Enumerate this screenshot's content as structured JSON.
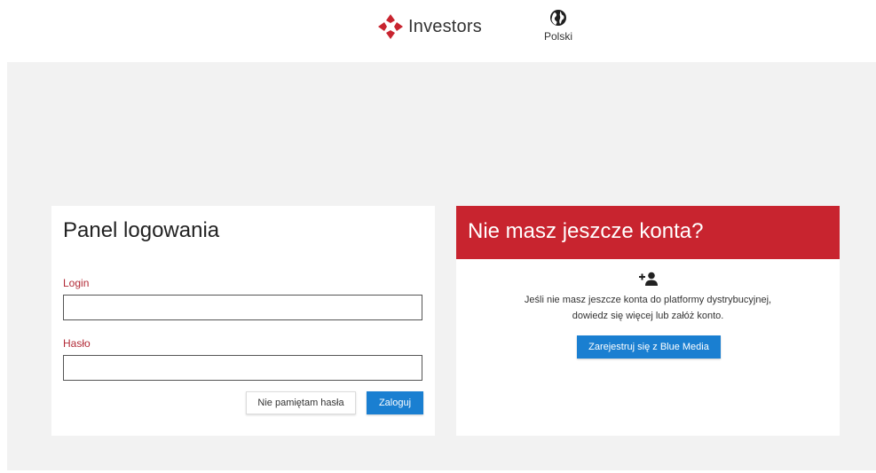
{
  "header": {
    "brand_name": "Investors",
    "language_label": "Polski",
    "brand_color": "#c8242f"
  },
  "login": {
    "title": "Panel logowania",
    "login_label": "Login",
    "login_value": "",
    "password_label": "Hasło",
    "password_value": "",
    "forgot_button": "Nie pamiętam hasła",
    "submit_button": "Zaloguj"
  },
  "register": {
    "title": "Nie masz jeszcze konta?",
    "icon": "add-user-icon",
    "text_line1": "Jeśli nie masz jeszcze konta do platformy dystrybucyjnej,",
    "text_line2": "dowiedz się więcej lub załóż konto.",
    "button": "Zarejestruj się z Blue Media"
  },
  "colors": {
    "accent_blue": "#1a7fd1",
    "accent_red": "#c8242f",
    "label_red": "#b22a36",
    "background": "#f2f2f2"
  },
  "icons": {
    "logo": "investors-logo-icon",
    "language": "globe-icon",
    "register": "add-user-icon"
  }
}
